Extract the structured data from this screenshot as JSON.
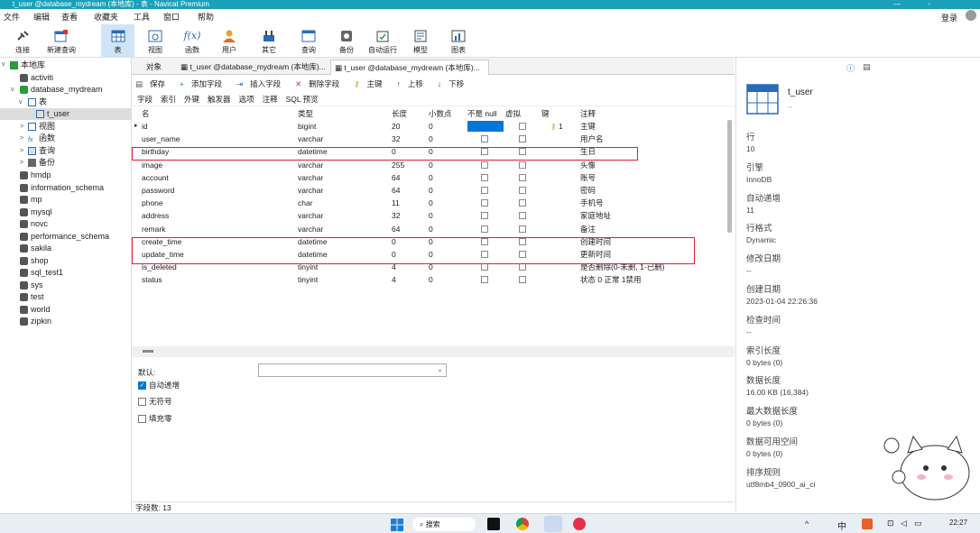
{
  "window": {
    "title": "t_user @database_mydream (本地库) - 表 - Navicat Premium"
  },
  "menu": {
    "items": [
      "文件",
      "编辑",
      "查看",
      "收藏夹",
      "工具",
      "窗口",
      "帮助"
    ],
    "login": "登录"
  },
  "toolbar": {
    "items": [
      {
        "label": "连接",
        "icon": "plug-icon"
      },
      {
        "label": "新建查询",
        "icon": "new-query-icon"
      },
      {
        "label": "表",
        "icon": "table-icon"
      },
      {
        "label": "视图",
        "icon": "view-icon"
      },
      {
        "label": "函数",
        "icon": "function-icon"
      },
      {
        "label": "用户",
        "icon": "user-icon"
      },
      {
        "label": "其它",
        "icon": "tools-icon"
      },
      {
        "label": "查询",
        "icon": "query-icon"
      },
      {
        "label": "备份",
        "icon": "backup-icon"
      },
      {
        "label": "自动运行",
        "icon": "schedule-icon"
      },
      {
        "label": "模型",
        "icon": "model-icon"
      },
      {
        "label": "图表",
        "icon": "chart-icon"
      }
    ]
  },
  "sidebar": {
    "root": "本地库",
    "db": "database_mydream",
    "activiti": "activiti",
    "tables_group": "表",
    "selected_table": "t_user",
    "groups": [
      "视图",
      "函数",
      "查询",
      "备份"
    ],
    "databases": [
      "hmdp",
      "information_schema",
      "mp",
      "mysql",
      "novc",
      "performance_schema",
      "sakila",
      "shop",
      "sql_test1",
      "sys",
      "test",
      "world",
      "zipkin"
    ]
  },
  "tabs": {
    "objects": "对象",
    "tab1": "t_user @database_mydream (本地库)...",
    "tab2": "t_user @database_mydream (本地库)..."
  },
  "subtoolbar": {
    "save": "保存",
    "add_field": "添加字段",
    "insert_field": "插入字段",
    "delete_field": "删除字段",
    "primary_key": "主键",
    "move_up": "上移",
    "move_down": "下移"
  },
  "designtabs": [
    "字段",
    "索引",
    "外键",
    "触发器",
    "选项",
    "注释",
    "SQL 预览"
  ],
  "grid": {
    "headers": [
      "名",
      "类型",
      "长度",
      "小数点",
      "不是 null",
      "虚拟",
      "键",
      "注释"
    ],
    "rows": [
      {
        "name": "id",
        "type": "bigint",
        "len": "20",
        "dec": "0",
        "notnull": true,
        "key": "1",
        "comment": "主键"
      },
      {
        "name": "user_name",
        "type": "varchar",
        "len": "32",
        "dec": "0",
        "notnull": false,
        "key": "",
        "comment": "用户名"
      },
      {
        "name": "birthday",
        "type": "datetime",
        "len": "0",
        "dec": "0",
        "notnull": false,
        "key": "",
        "comment": "生日"
      },
      {
        "name": "image",
        "type": "varchar",
        "len": "255",
        "dec": "0",
        "notnull": false,
        "key": "",
        "comment": "头像"
      },
      {
        "name": "account",
        "type": "varchar",
        "len": "64",
        "dec": "0",
        "notnull": false,
        "key": "",
        "comment": "账号"
      },
      {
        "name": "password",
        "type": "varchar",
        "len": "64",
        "dec": "0",
        "notnull": false,
        "key": "",
        "comment": "密码"
      },
      {
        "name": "phone",
        "type": "char",
        "len": "11",
        "dec": "0",
        "notnull": false,
        "key": "",
        "comment": "手机号"
      },
      {
        "name": "address",
        "type": "varchar",
        "len": "32",
        "dec": "0",
        "notnull": false,
        "key": "",
        "comment": "家庭地址"
      },
      {
        "name": "remark",
        "type": "varchar",
        "len": "64",
        "dec": "0",
        "notnull": false,
        "key": "",
        "comment": "备注"
      },
      {
        "name": "create_time",
        "type": "datetime",
        "len": "0",
        "dec": "0",
        "notnull": false,
        "key": "",
        "comment": "创建时间"
      },
      {
        "name": "update_time",
        "type": "datetime",
        "len": "0",
        "dec": "0",
        "notnull": false,
        "key": "",
        "comment": "更新时间"
      },
      {
        "name": "is_deleted",
        "type": "tinyint",
        "len": "4",
        "dec": "0",
        "notnull": false,
        "key": "",
        "comment": "是否删除(0-未删, 1-已删)"
      },
      {
        "name": "status",
        "type": "tinyint",
        "len": "4",
        "dec": "0",
        "notnull": false,
        "key": "",
        "comment": "状态 0 正常 1禁用"
      }
    ]
  },
  "props": {
    "default_label": "默认:",
    "auto_increment": "自动递增",
    "unsigned": "无符号",
    "zerofill": "填充零"
  },
  "status": {
    "field_count": "字段数: 13"
  },
  "right": {
    "name": "t_user",
    "comment": "--",
    "fields": [
      {
        "label": "行",
        "value": "10"
      },
      {
        "label": "引擎",
        "value": "InnoDB"
      },
      {
        "label": "自动递增",
        "value": "11"
      },
      {
        "label": "行格式",
        "value": "Dynamic"
      },
      {
        "label": "修改日期",
        "value": "--"
      },
      {
        "label": "创建日期",
        "value": "2023-01-04 22:26:36"
      },
      {
        "label": "检查时间",
        "value": "--"
      },
      {
        "label": "索引长度",
        "value": "0 bytes (0)"
      },
      {
        "label": "数据长度",
        "value": "16.00 KB (16,384)"
      },
      {
        "label": "最大数据长度",
        "value": "0 bytes (0)"
      },
      {
        "label": "数据可用空间",
        "value": "0 bytes (0)"
      },
      {
        "label": "排序规则",
        "value": "utf8mb4_0900_ai_ci"
      }
    ]
  },
  "taskbar": {
    "search": "搜索",
    "time": "22:27",
    "ime": "中"
  }
}
